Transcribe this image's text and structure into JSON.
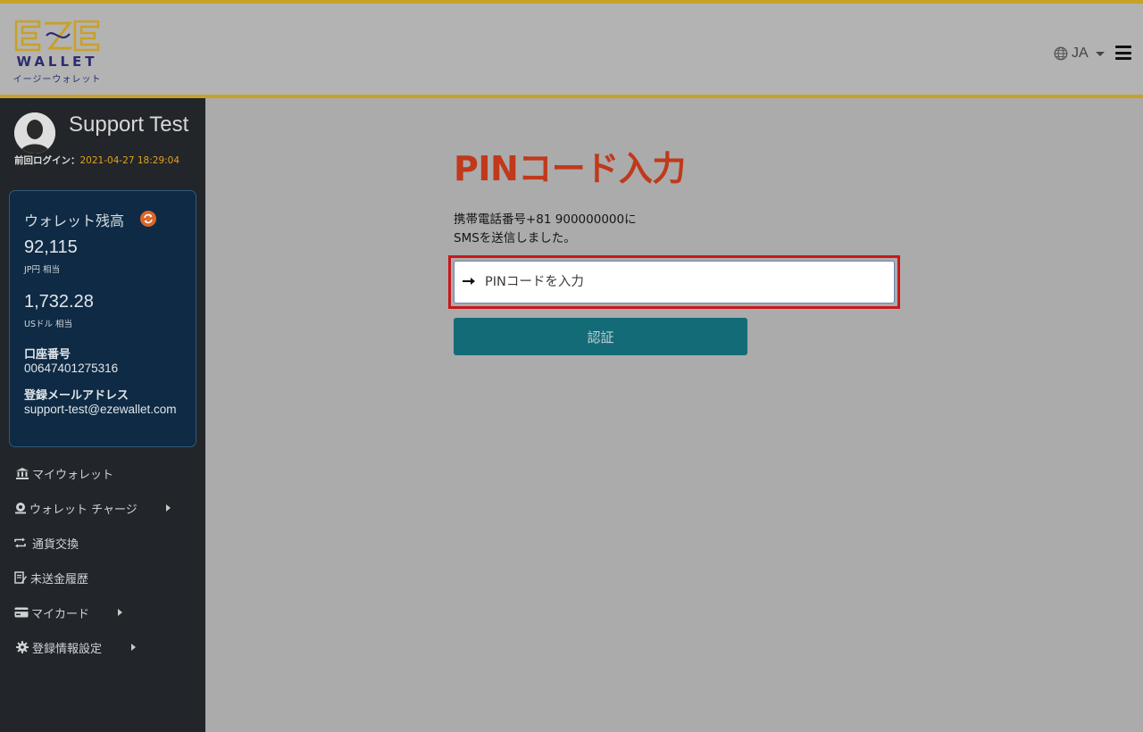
{
  "header": {
    "logo_wallet": "WALLET",
    "logo_sub": "イージーウォレット",
    "language": "JA"
  },
  "sidebar": {
    "user_name": "Support Test",
    "last_login_label": "前回ログイン：",
    "last_login_time": "2021-04-27 18:29:04",
    "balance": {
      "title": "ウォレット残高",
      "jpy_amount": "92,115",
      "jpy_unit": "JP円 相当",
      "usd_amount": "1,732.28",
      "usd_unit": "USドル 相当",
      "account_label": "口座番号",
      "account_number": "00647401275316",
      "email_label": "登録メールアドレス",
      "email": "support-test@ezewallet.com"
    },
    "nav": [
      {
        "label": "マイウォレット",
        "icon": "bank-icon",
        "has_submenu": false
      },
      {
        "label": "ウォレット チャージ",
        "icon": "deposit-icon",
        "has_submenu": true
      },
      {
        "label": "通貨交換",
        "icon": "exchange-icon",
        "has_submenu": false
      },
      {
        "label": "未送金履歴",
        "icon": "history-icon",
        "has_submenu": false
      },
      {
        "label": "マイカード",
        "icon": "credit-card-icon",
        "has_submenu": true
      },
      {
        "label": "登録情報設定",
        "icon": "gear-icon",
        "has_submenu": true
      }
    ]
  },
  "main": {
    "title": "PINコード入力",
    "message_line1": "携帯電話番号+81 900000000に",
    "message_line2": "SMSを送信しました。",
    "pin_placeholder": "PINコードを入力",
    "verify_label": "認証"
  },
  "colors": {
    "accent_gold": "#c8a128",
    "title_red": "#c0391b",
    "button_teal": "#136b78",
    "highlight_red": "#c8181c",
    "sidebar_bg": "#22252a",
    "card_bg": "#0e2a44",
    "timestamp_orange": "#e3a21a"
  }
}
